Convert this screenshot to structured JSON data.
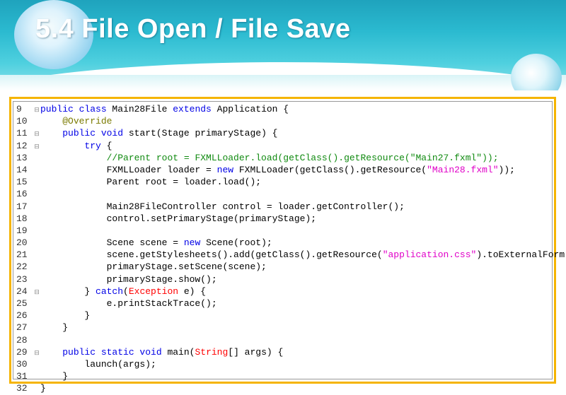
{
  "slide": {
    "title": "5.4 File Open / File Save"
  },
  "code": {
    "lines": [
      {
        "n": "9",
        "fold": "⊟",
        "segs": [
          [
            "kw",
            "public class "
          ],
          [
            "",
            "Main28File "
          ],
          [
            "kw",
            "extends "
          ],
          [
            "",
            "Application {"
          ]
        ]
      },
      {
        "n": "10",
        "fold": "",
        "segs": [
          [
            "",
            "    "
          ],
          [
            "ann",
            "@Override"
          ]
        ]
      },
      {
        "n": "11",
        "fold": "⊟",
        "segs": [
          [
            "",
            "    "
          ],
          [
            "kw",
            "public void "
          ],
          [
            "",
            "start(Stage primaryStage) {"
          ]
        ]
      },
      {
        "n": "12",
        "fold": "⊟",
        "segs": [
          [
            "",
            "        "
          ],
          [
            "kw",
            "try "
          ],
          [
            "",
            "{"
          ]
        ]
      },
      {
        "n": "13",
        "fold": "",
        "segs": [
          [
            "",
            "            "
          ],
          [
            "com",
            "//Parent root = FXMLLoader.load(getClass().getResource(\"Main27.fxml\"));"
          ]
        ]
      },
      {
        "n": "14",
        "fold": "",
        "segs": [
          [
            "",
            "            FXMLLoader loader = "
          ],
          [
            "kw",
            "new "
          ],
          [
            "",
            "FXMLLoader(getClass().getResource("
          ],
          [
            "str",
            "\"Main28.fxml\""
          ],
          [
            "",
            "));"
          ]
        ]
      },
      {
        "n": "15",
        "fold": "",
        "segs": [
          [
            "",
            "            Parent root = loader.load();"
          ]
        ]
      },
      {
        "n": "16",
        "fold": "",
        "segs": []
      },
      {
        "n": "17",
        "fold": "",
        "segs": [
          [
            "",
            "            Main28FileController control = loader.getController();"
          ]
        ]
      },
      {
        "n": "18",
        "fold": "",
        "segs": [
          [
            "",
            "            control.setPrimaryStage(primaryStage);"
          ]
        ]
      },
      {
        "n": "19",
        "fold": "",
        "segs": []
      },
      {
        "n": "20",
        "fold": "",
        "segs": [
          [
            "",
            "            Scene scene = "
          ],
          [
            "kw",
            "new "
          ],
          [
            "",
            "Scene(root);"
          ]
        ]
      },
      {
        "n": "21",
        "fold": "",
        "segs": [
          [
            "",
            "            scene.getStylesheets().add(getClass().getResource("
          ],
          [
            "str",
            "\"application.css\""
          ],
          [
            "",
            ").toExternalForm());"
          ]
        ]
      },
      {
        "n": "22",
        "fold": "",
        "segs": [
          [
            "",
            "            primaryStage.setScene(scene);"
          ]
        ]
      },
      {
        "n": "23",
        "fold": "",
        "segs": [
          [
            "",
            "            primaryStage.show();"
          ]
        ]
      },
      {
        "n": "24",
        "fold": "⊟",
        "segs": [
          [
            "",
            "        } "
          ],
          [
            "kw",
            "catch"
          ],
          [
            "",
            "("
          ],
          [
            "err",
            "Exception "
          ],
          [
            "",
            "e) {"
          ]
        ]
      },
      {
        "n": "25",
        "fold": "",
        "segs": [
          [
            "",
            "            e.printStackTrace();"
          ]
        ]
      },
      {
        "n": "26",
        "fold": "",
        "segs": [
          [
            "",
            "        }"
          ]
        ]
      },
      {
        "n": "27",
        "fold": "",
        "segs": [
          [
            "",
            "    }"
          ]
        ]
      },
      {
        "n": "28",
        "fold": "",
        "segs": []
      },
      {
        "n": "29",
        "fold": "⊟",
        "segs": [
          [
            "",
            "    "
          ],
          [
            "kw",
            "public static void "
          ],
          [
            "",
            "main("
          ],
          [
            "err",
            "String"
          ],
          [
            "",
            "[] args) {"
          ]
        ]
      },
      {
        "n": "30",
        "fold": "",
        "segs": [
          [
            "",
            "        launch(args);"
          ]
        ]
      },
      {
        "n": "31",
        "fold": "",
        "segs": [
          [
            "",
            "    }"
          ]
        ]
      },
      {
        "n": "32",
        "fold": "",
        "segs": [
          [
            "",
            "}"
          ]
        ]
      }
    ]
  },
  "colors": {
    "keyword": "#0000e6",
    "annotation": "#7a7a00",
    "comment": "#108a10",
    "string": "#e000c8",
    "type_error": "#ff0000",
    "panel_border": "#f5b400",
    "banner": "#2bbad0"
  }
}
